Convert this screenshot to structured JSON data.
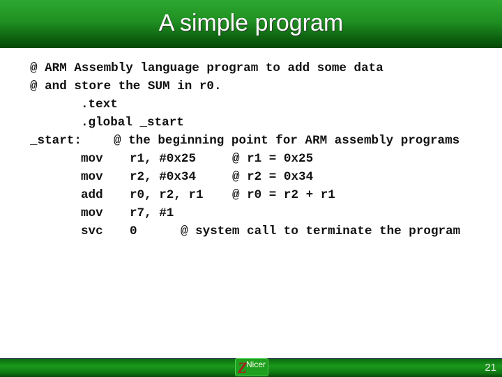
{
  "slide": {
    "title": "A simple program",
    "page_number": "21",
    "logo_text": "Nicer",
    "logo_letter": "Z"
  },
  "code": {
    "l1": "@ ARM Assembly language program to add some data",
    "l2": "@ and store the SUM in r0.",
    "l3": ".text",
    "l4": ".global _start",
    "l5_label": "_start:",
    "l5_comment": "@ the beginning point for ARM assembly programs",
    "l6_op": "mov",
    "l6_args": "r1, #0x25",
    "l6_comment": "@ r1 = 0x25",
    "l7_op": "mov",
    "l7_args": "r2, #0x34",
    "l7_comment": "@ r2 = 0x34",
    "l8_op": "add",
    "l8_args": "r0, r2, r1",
    "l8_comment": "@ r0 = r2 + r1",
    "l9_op": "mov",
    "l9_args": "r7, #1",
    "l10_op": "svc",
    "l10_args": "0",
    "l10_comment": "@ system call to terminate the program"
  }
}
